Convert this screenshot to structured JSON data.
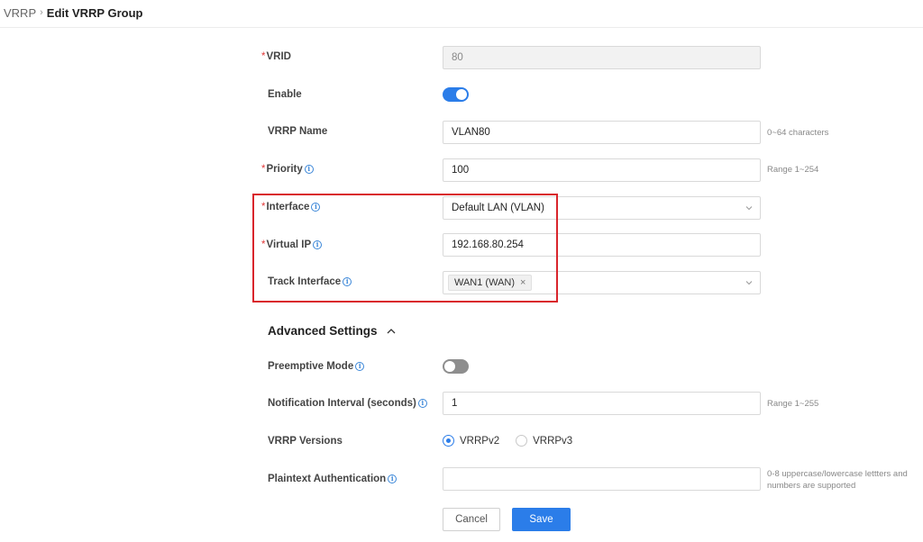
{
  "breadcrumb": {
    "parent": "VRRP",
    "separator": "›",
    "current": "Edit VRRP Group"
  },
  "form": {
    "vrid": {
      "label": "VRID",
      "value": "80"
    },
    "enable": {
      "label": "Enable",
      "on": true
    },
    "vrrp_name": {
      "label": "VRRP Name",
      "value": "VLAN80",
      "hint": "0~64 characters"
    },
    "priority": {
      "label": "Priority",
      "value": "100",
      "hint": "Range 1~254"
    },
    "interface": {
      "label": "Interface",
      "value": "Default LAN (VLAN)"
    },
    "virtual_ip": {
      "label": "Virtual IP",
      "value": "192.168.80.254"
    },
    "track_interface": {
      "label": "Track Interface",
      "tag": "WAN1 (WAN)",
      "tag_remove": "×"
    }
  },
  "advanced": {
    "title": "Advanced Settings",
    "preemptive": {
      "label": "Preemptive Mode",
      "on": false
    },
    "notification": {
      "label": "Notification Interval (seconds)",
      "value": "1",
      "hint": "Range 1~255"
    },
    "versions": {
      "label": "VRRP Versions",
      "options": [
        "VRRPv2",
        "VRRPv3"
      ],
      "selected": "VRRPv2"
    },
    "auth": {
      "label": "Plaintext Authentication",
      "value": "",
      "hint_line1": "0-8 uppercase/lowercase lettters and",
      "hint_line2": "numbers are supported"
    }
  },
  "actions": {
    "cancel": "Cancel",
    "save": "Save"
  },
  "required_mark": "*",
  "info_glyph": "i",
  "colors": {
    "primary": "#2b7de9",
    "required": "#e23b3b",
    "highlight": "#d9252c"
  },
  "icons": {
    "info": "info-circle-icon",
    "dropdown": "chevron-down-icon",
    "collapse": "chevron-up-icon"
  }
}
